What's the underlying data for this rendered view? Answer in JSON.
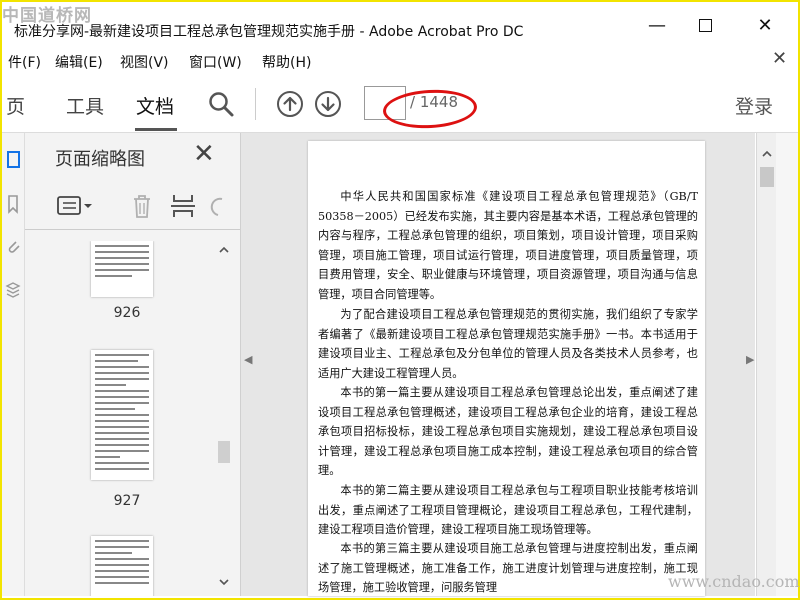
{
  "watermark": {
    "top_left": "中国道桥网",
    "bottom_right": "www.cndao.com"
  },
  "window": {
    "title": "标准分享网-最新建设项目工程总承包管理规范实施手册 - Adobe Acrobat Pro DC",
    "controls": {
      "minimize": "—",
      "close": "✕"
    }
  },
  "menubar": {
    "items": [
      "件(F)",
      "编辑(E)",
      "视图(V)",
      "窗口(W)",
      "帮助(H)"
    ],
    "close_doc": "✕"
  },
  "toolbar": {
    "tabs": [
      "页",
      "工具",
      "文档"
    ],
    "active_tab": "文档",
    "page_input_value": "",
    "page_total": "/ 1448",
    "login": "登录",
    "icons": [
      "search-icon",
      "arrow-up-icon",
      "arrow-down-icon"
    ]
  },
  "thumbnails_panel": {
    "title": "页面缩略图",
    "close": "✕",
    "tools": [
      "options-icon",
      "delete-icon",
      "extract-icon",
      "rotate-icon"
    ],
    "pages": [
      {
        "label": "926"
      },
      {
        "label": "927"
      },
      {
        "label": ""
      }
    ]
  },
  "document": {
    "paragraphs": [
      "中华人民共和国国家标准《建设项目工程总承包管理规范》（GB/T 50358－2005）已经发布实施，其主要内容是基本术语，工程总承包管理的内容与程序，工程总承包管理的组织，项目策划，项目设计管理，项目采购管理，项目施工管理，项目试运行管理，项目进度管理，项目质量管理，项目费用管理，安全、职业健康与环境管理，项目资源管理，项目沟通与信息管理，项目合同管理等。",
      "为了配合建设项目工程总承包管理规范的贯彻实施，我们组织了专家学者编著了《最新建设项目工程总承包管理规范实施手册》一书。本书适用于建设项目业主、工程总承包及分包单位的管理人员及各类技术人员参考，也适用广大建设工程管理人员。",
      "本书的第一篇主要从建设项目工程总承包管理总论出发，重点阐述了建设项目工程总承包管理概述，建设项目工程总承包企业的培育，建设工程总承包项目招标投标，建设工程总承包项目实施规划，建设工程总承包项目设计管理，建设工程总承包项目施工成本控制，建设工程总承包项目的综合管理。",
      "本书的第二篇主要从建设项目工程总承包与工程项目职业技能考核培训出发，重点阐述了工程项目管理概论，建设项目工程总承包，工程代建制，建设工程项目造价管理，建设工程项目施工现场管理等。",
      "本书的第三篇主要从建设项目施工总承包管理与进度控制出发，重点阐述了施工管理概述，施工准备工作，施工进度计划管理与进度控制，施工现场管理，施工验收管理，问服务管理"
    ]
  }
}
